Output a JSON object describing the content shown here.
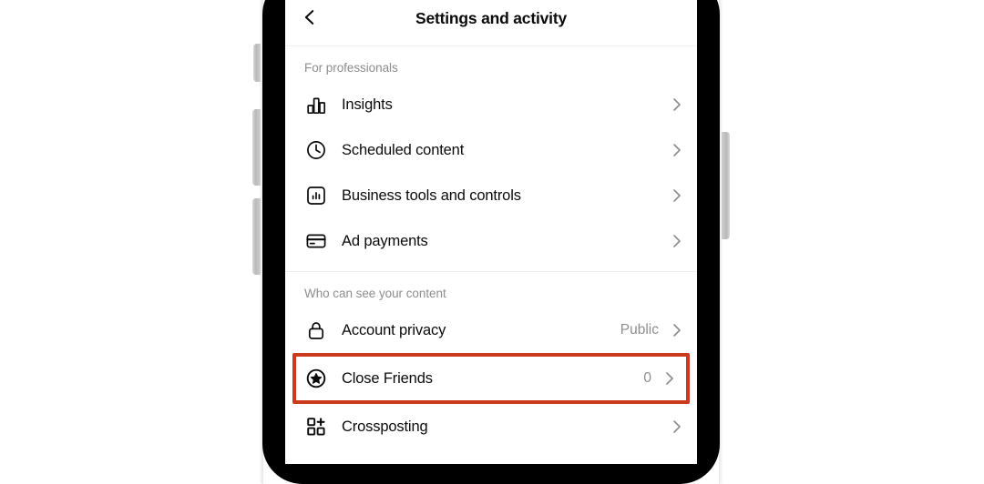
{
  "device": {
    "frame_color": "#000000",
    "buttons": [
      "silence-switch",
      "volume-up",
      "volume-down",
      "power"
    ]
  },
  "highlight": {
    "color": "#cc3a1e",
    "target": "Close Friends"
  },
  "header": {
    "back_icon": "chevron-left-icon",
    "title": "Settings and activity"
  },
  "sections": [
    {
      "title": "For professionals",
      "rows": [
        {
          "icon": "bar-chart-icon",
          "label": "Insights",
          "value": "",
          "chevron": "chevron-right-icon",
          "highlighted": false
        },
        {
          "icon": "clock-icon",
          "label": "Scheduled content",
          "value": "",
          "chevron": "chevron-right-icon",
          "highlighted": false
        },
        {
          "icon": "chart-box-icon",
          "label": "Business tools and controls",
          "value": "",
          "chevron": "chevron-right-icon",
          "highlighted": false
        },
        {
          "icon": "credit-card-icon",
          "label": "Ad payments",
          "value": "",
          "chevron": "chevron-right-icon",
          "highlighted": false
        }
      ]
    },
    {
      "title": "Who can see your content",
      "rows": [
        {
          "icon": "lock-icon",
          "label": "Account privacy",
          "value": "Public",
          "chevron": "chevron-right-icon",
          "highlighted": false
        },
        {
          "icon": "star-circle-icon",
          "label": "Close Friends",
          "value": "0",
          "chevron": "chevron-right-icon",
          "highlighted": true
        },
        {
          "icon": "grid-plus-icon",
          "label": "Crossposting",
          "value": "",
          "chevron": "chevron-right-icon",
          "highlighted": false
        }
      ]
    }
  ]
}
